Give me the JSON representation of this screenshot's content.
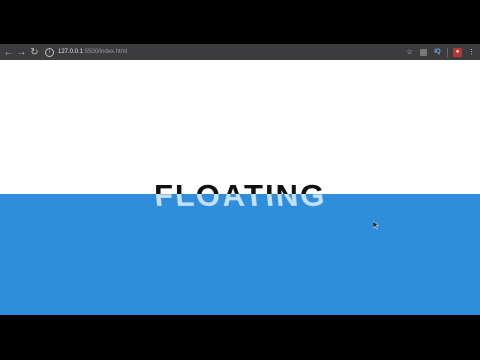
{
  "browser": {
    "url_host": "127.0.0.1",
    "url_path": ":5500/index.html",
    "icons": {
      "back": "arrow-left-icon",
      "forward": "arrow-right-icon",
      "reload": "reload-icon",
      "info": "info-icon",
      "bookmark": "star-icon"
    }
  },
  "page": {
    "headline": "FLOATING",
    "water_color": "#2f8edb",
    "background_color": "#ffffff"
  }
}
